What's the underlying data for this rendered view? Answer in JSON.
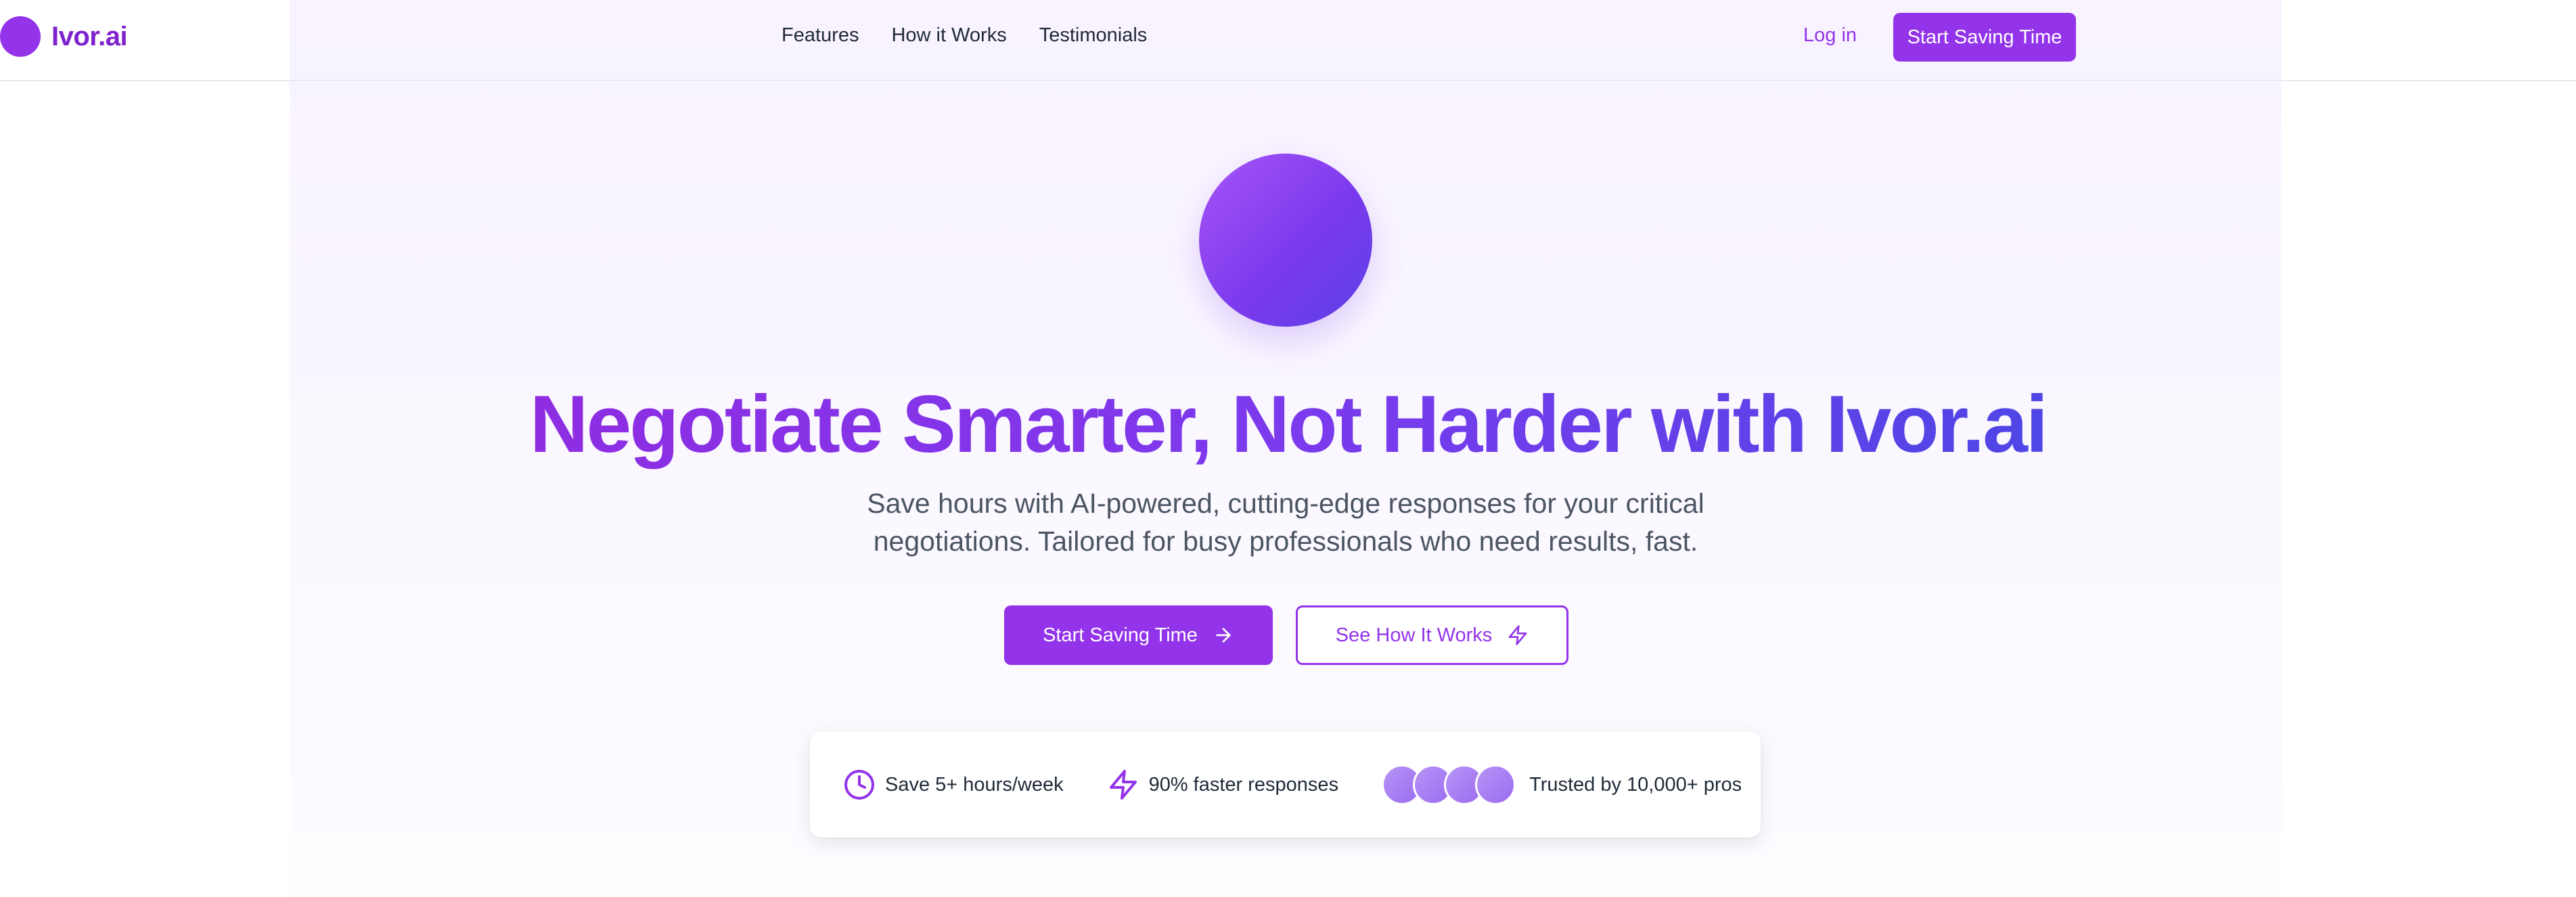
{
  "brand": {
    "name": "Ivor.ai",
    "logo_icon": "circle-logo-icon"
  },
  "nav": {
    "links": [
      "Features",
      "How it Works",
      "Testimonials"
    ],
    "login_label": "Log in",
    "cta_label": "Start Saving Time"
  },
  "hero": {
    "title": "Negotiate Smarter, Not Harder with Ivor.ai",
    "subtitle": "Save hours with AI-powered, cutting-edge responses for your critical negotiations. Tailored for busy professionals who need results, fast.",
    "primary_cta": {
      "label": "Start Saving Time",
      "icon": "arrow-right-icon"
    },
    "secondary_cta": {
      "label": "See How It Works",
      "icon": "lightning-icon"
    }
  },
  "stats": [
    {
      "icon": "clock-icon",
      "text": "Save 5+ hours/week"
    },
    {
      "icon": "lightning-icon",
      "text": "90% faster responses"
    },
    {
      "icon": "avatar-stack",
      "text": "Trusted by 10,000+ pros"
    }
  ],
  "colors": {
    "accent": "#9333ea",
    "accent_dark": "#7e22ce",
    "gradient_end": "#4f46e5",
    "text": "#1f2937",
    "muted_text": "#4b5563"
  }
}
